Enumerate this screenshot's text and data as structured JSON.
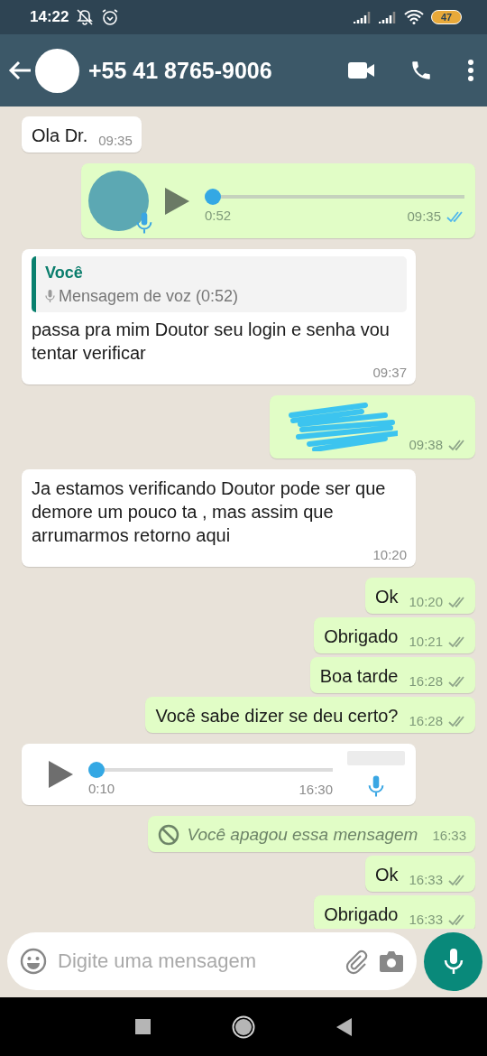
{
  "status_bar": {
    "time": "14:22",
    "battery": "47"
  },
  "header": {
    "contact": "+55 41 8765-9006"
  },
  "messages": [
    {
      "kind": "text",
      "outgoing": false,
      "text": "Ola Dr.",
      "time": "09:35"
    },
    {
      "kind": "voice",
      "outgoing": true,
      "duration": "0:52",
      "level": 0,
      "time": "09:35",
      "read": true
    },
    {
      "kind": "reply",
      "outgoing": false,
      "quote_author": "Você",
      "quote_text": "Mensagem de voz (0:52)",
      "text": "passa pra mim Doutor seu login e senha vou tentar verificar",
      "time": "09:37"
    },
    {
      "kind": "redacted",
      "outgoing": true,
      "time": "09:38",
      "read": false
    },
    {
      "kind": "text",
      "outgoing": false,
      "text": "Ja estamos verificando Doutor pode ser que demore um pouco ta , mas assim que arrumarmos retorno aqui",
      "time": "10:20"
    },
    {
      "kind": "text",
      "outgoing": true,
      "text": "Ok",
      "time": "10:20",
      "read": false
    },
    {
      "kind": "text",
      "outgoing": true,
      "text": "Obrigado",
      "time": "10:21",
      "read": false
    },
    {
      "kind": "text",
      "outgoing": true,
      "text": "Boa tarde",
      "time": "16:28",
      "read": false
    },
    {
      "kind": "text",
      "outgoing": true,
      "text": "Você sabe dizer se deu certo?",
      "time": "16:28",
      "read": false
    },
    {
      "kind": "voice",
      "outgoing": false,
      "duration": "0:10",
      "level": 0,
      "time": "16:30"
    },
    {
      "kind": "deleted",
      "outgoing": true,
      "text": "Você apagou essa mensagem",
      "time": "16:33"
    },
    {
      "kind": "text",
      "outgoing": true,
      "text": "Ok",
      "time": "16:33",
      "read": false
    },
    {
      "kind": "text",
      "outgoing": true,
      "text": "Obrigado",
      "time": "16:33",
      "read": false
    }
  ],
  "composer": {
    "placeholder": "Digite uma mensagem"
  }
}
